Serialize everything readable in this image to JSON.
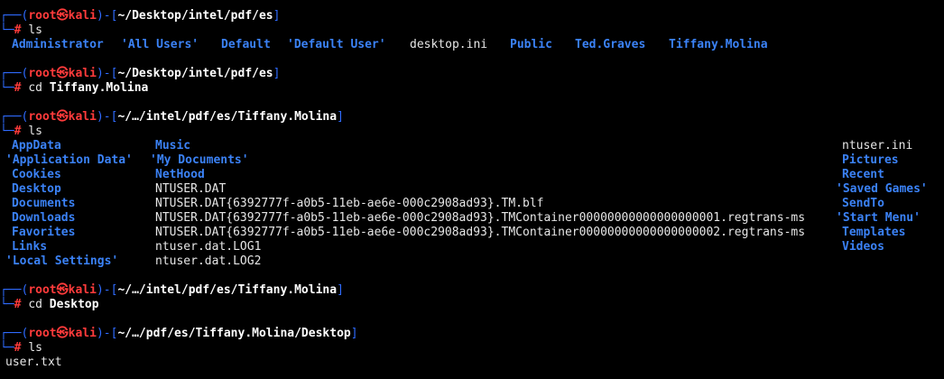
{
  "prompt_user": "root",
  "prompt_host": "kali",
  "prompt_at": "㉿",
  "blocks": [
    {
      "path": "~/Desktop/intel/pdf/es",
      "command": "ls",
      "argument": "",
      "output": [
        {
          "text": "Administrator",
          "type": "dir"
        },
        {
          "text": "'All Users'",
          "type": "dir"
        },
        {
          "text": "Default",
          "type": "dir"
        },
        {
          "text": "'Default User'",
          "type": "dir"
        },
        {
          "text": "desktop.ini",
          "type": "file"
        },
        {
          "text": "Public",
          "type": "dir"
        },
        {
          "text": "Ted.Graves",
          "type": "dir"
        },
        {
          "text": "Tiffany.Molina",
          "type": "dir"
        }
      ]
    },
    {
      "path": "~/Desktop/intel/pdf/es",
      "command": "cd",
      "argument": "Tiffany.Molina",
      "output": []
    },
    {
      "path": "~/…/intel/pdf/es/Tiffany.Molina",
      "command": "ls",
      "argument": "",
      "output": [
        {
          "text": "AppData",
          "type": "dir"
        },
        {
          "text": "'Application Data'",
          "type": "dir"
        },
        {
          "text": "Cookies",
          "type": "dir"
        },
        {
          "text": "Desktop",
          "type": "dir"
        },
        {
          "text": "Documents",
          "type": "dir"
        },
        {
          "text": "Downloads",
          "type": "dir"
        },
        {
          "text": "Favorites",
          "type": "dir"
        },
        {
          "text": "Links",
          "type": "dir"
        },
        {
          "text": "'Local Settings'",
          "type": "dir"
        },
        {
          "text": "Music",
          "type": "dir"
        },
        {
          "text": "'My Documents'",
          "type": "dir"
        },
        {
          "text": "NetHood",
          "type": "dir"
        },
        {
          "text": "NTUSER.DAT",
          "type": "file"
        },
        {
          "text": "NTUSER.DAT{6392777f-a0b5-11eb-ae6e-000c2908ad93}.TM.blf",
          "type": "file"
        },
        {
          "text": "NTUSER.DAT{6392777f-a0b5-11eb-ae6e-000c2908ad93}.TMContainer00000000000000000001.regtrans-ms",
          "type": "file"
        },
        {
          "text": "NTUSER.DAT{6392777f-a0b5-11eb-ae6e-000c2908ad93}.TMContainer00000000000000000002.regtrans-ms",
          "type": "file"
        },
        {
          "text": "ntuser.dat.LOG1",
          "type": "file"
        },
        {
          "text": "ntuser.dat.LOG2",
          "type": "file"
        },
        {
          "text": "ntuser.ini",
          "type": "file"
        },
        {
          "text": "Pictures",
          "type": "dir"
        },
        {
          "text": "Recent",
          "type": "dir"
        },
        {
          "text": "'Saved Games'",
          "type": "dir"
        },
        {
          "text": "SendTo",
          "type": "dir"
        },
        {
          "text": "'Start Menu'",
          "type": "dir"
        },
        {
          "text": "Templates",
          "type": "dir"
        },
        {
          "text": "Videos",
          "type": "dir"
        }
      ]
    },
    {
      "path": "~/…/intel/pdf/es/Tiffany.Molina",
      "command": "cd",
      "argument": "Desktop",
      "output": []
    },
    {
      "path": "~/…/pdf/es/Tiffany.Molina/Desktop",
      "command": "ls",
      "argument": "",
      "output": [
        {
          "text": "user.txt",
          "type": "file"
        }
      ]
    }
  ]
}
